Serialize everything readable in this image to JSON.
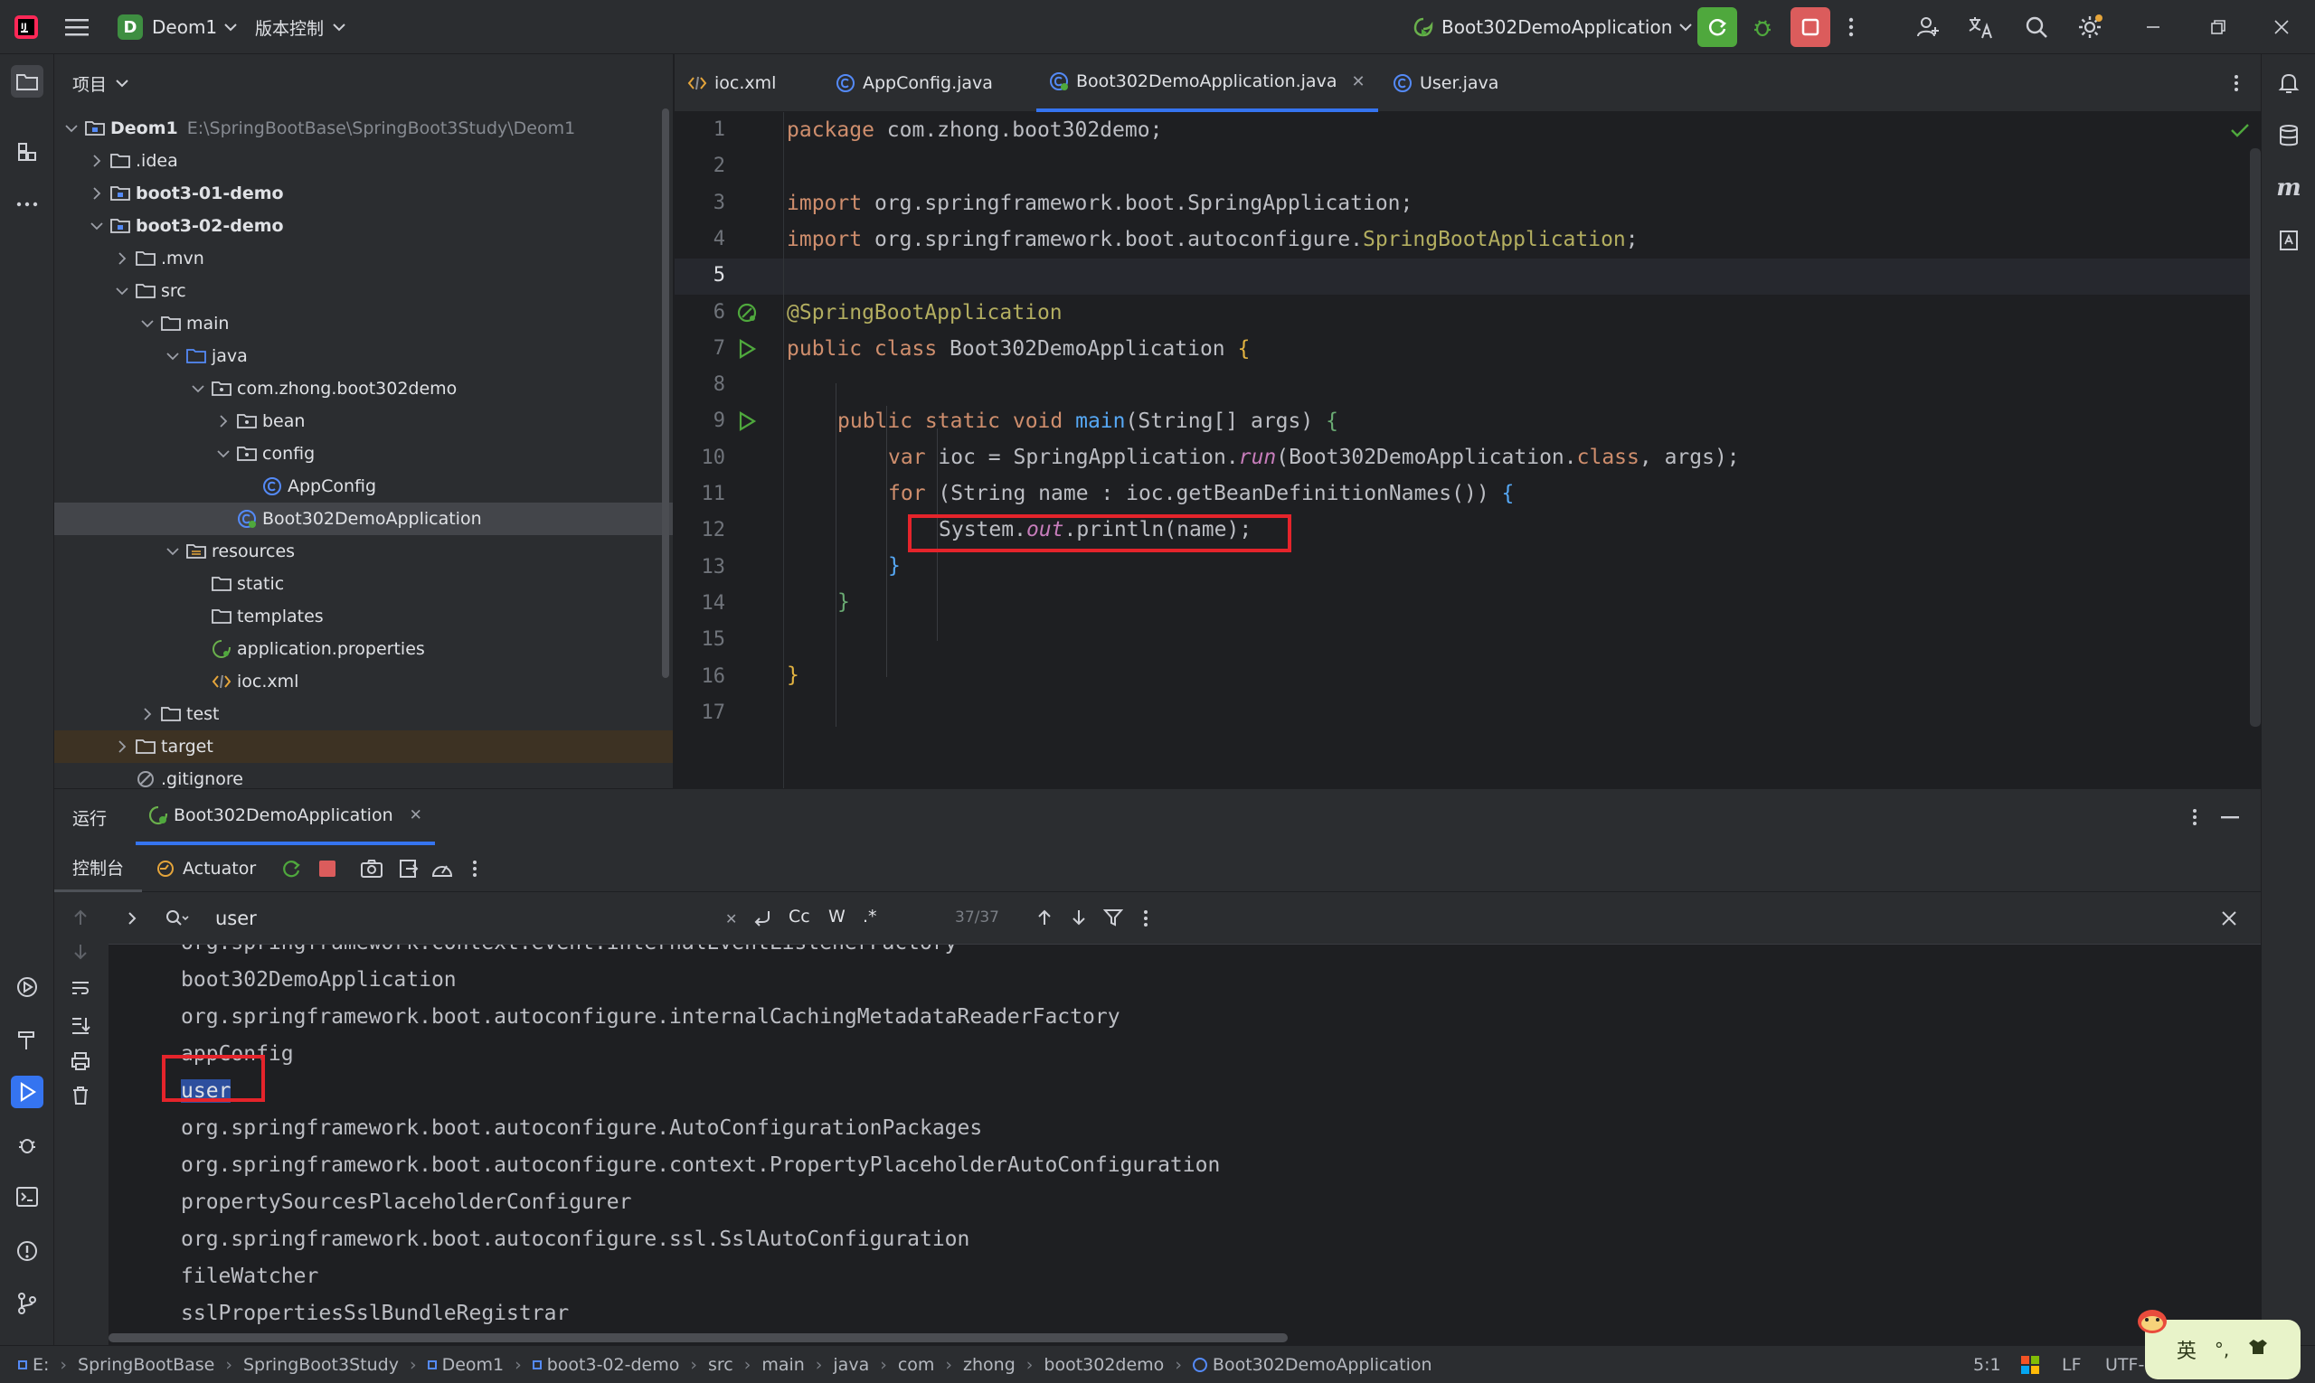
{
  "titlebar": {
    "project_badge": "D",
    "project_name": "Deom1",
    "vcs_label": "版本控制",
    "run_config": "Boot302DemoApplication"
  },
  "project_panel": {
    "title": "项目",
    "tree": [
      {
        "label": "Deom1",
        "path": "E:\\SpringBootBase\\SpringBoot3Study\\Deom1",
        "icon": "module-folder-icon"
      },
      {
        "label": ".idea",
        "icon": "folder-icon"
      },
      {
        "label": "boot3-01-demo",
        "icon": "module-folder-icon"
      },
      {
        "label": "boot3-02-demo",
        "icon": "module-folder-icon"
      },
      {
        "label": ".mvn",
        "icon": "folder-icon"
      },
      {
        "label": "src",
        "icon": "folder-icon"
      },
      {
        "label": "main",
        "icon": "folder-icon"
      },
      {
        "label": "java",
        "icon": "source-folder-icon"
      },
      {
        "label": "com.zhong.boot302demo",
        "icon": "package-icon"
      },
      {
        "label": "bean",
        "icon": "package-icon"
      },
      {
        "label": "config",
        "icon": "package-icon"
      },
      {
        "label": "AppConfig",
        "icon": "class-icon"
      },
      {
        "label": "Boot302DemoApplication",
        "icon": "spring-class-icon"
      },
      {
        "label": "resources",
        "icon": "resources-folder-icon"
      },
      {
        "label": "static",
        "icon": "folder-icon"
      },
      {
        "label": "templates",
        "icon": "folder-icon"
      },
      {
        "label": "application.properties",
        "icon": "properties-icon"
      },
      {
        "label": "ioc.xml",
        "icon": "xml-icon"
      },
      {
        "label": "test",
        "icon": "folder-icon"
      },
      {
        "label": "target",
        "icon": "folder-icon"
      },
      {
        "label": ".gitignore",
        "icon": "gitignore-icon"
      }
    ]
  },
  "editor_tabs": [
    {
      "label": "ioc.xml",
      "icon": "xml-icon"
    },
    {
      "label": "AppConfig.java",
      "icon": "class-icon"
    },
    {
      "label": "Boot302DemoApplication.java",
      "icon": "spring-class-icon"
    },
    {
      "label": "User.java",
      "icon": "class-icon"
    }
  ],
  "editor": {
    "line_numbers": [
      "1",
      "2",
      "3",
      "4",
      "5",
      "6",
      "7",
      "8",
      "9",
      "10",
      "11",
      "12",
      "13",
      "14",
      "15",
      "16",
      "17"
    ],
    "code": {
      "l1_kw": "package",
      "l1_rest": " com.zhong.boot302demo;",
      "l3_kw": "import",
      "l3_rest": " org.springframework.boot.SpringApplication;",
      "l4_kw": "import",
      "l4_rest": " org.springframework.boot.autoconfigure.",
      "l4_ann": "SpringBootApplication",
      "l4_end": ";",
      "l6_ann": "@SpringBootApplication",
      "l7_kw": "public class",
      "l7_name": " Boot302DemoApplication ",
      "l7_brace": "{",
      "l9_kw": "public static void",
      "l9_fn": "main",
      "l9_rest": "(String[] args) ",
      "l9_brace": "{",
      "l10_kw": "var",
      "l10_a": " ioc = SpringApplication.",
      "l10_st": "run",
      "l10_b": "(Boot302DemoApplication.",
      "l10_kw2": "class",
      "l10_c": ", args);",
      "l11_kw": "for",
      "l11_a": " (String name : ioc.getBeanDefinitionNames()) ",
      "l11_brace": "{",
      "l12_a": "System.",
      "l12_st": "out",
      "l12_b": ".println(name);",
      "l13_brace": "}",
      "l14_brace": "}",
      "l16_brace": "}"
    }
  },
  "run_panel": {
    "tab_run": "运行",
    "tab_app": "Boot302DemoApplication",
    "tab_console": "控制台",
    "tab_actuator": "Actuator",
    "search_value": "user",
    "search_opts": [
      "Cc",
      "W",
      ".*"
    ],
    "match_count": "37/37",
    "output": [
      "org.springframework.context.event.internalEventListenerFactory",
      "boot302DemoApplication",
      "org.springframework.boot.autoconfigure.internalCachingMetadataReaderFactory",
      "appConfig",
      "user",
      "org.springframework.boot.autoconfigure.AutoConfigurationPackages",
      "org.springframework.boot.autoconfigure.context.PropertyPlaceholderAutoConfiguration",
      "propertySourcesPlaceholderConfigurer",
      "org.springframework.boot.autoconfigure.ssl.SslAutoConfiguration",
      "fileWatcher",
      "sslPropertiesSslBundleRegistrar"
    ]
  },
  "statusbar": {
    "breadcrumbs": [
      "E:",
      "SpringBootBase",
      "SpringBoot3Study",
      "Deom1",
      "boot3-02-demo",
      "src",
      "main",
      "java",
      "com",
      "zhong",
      "boot302demo",
      "Boot302DemoApplication"
    ],
    "position": "5:1",
    "line_sep": "LF",
    "encoding": "UTF-",
    "ime": "英"
  },
  "colors": {
    "accent": "#3574f0",
    "highlight_box": "#e5242b",
    "run_green": "#4fa83d",
    "stop_red": "#db5c5c"
  }
}
